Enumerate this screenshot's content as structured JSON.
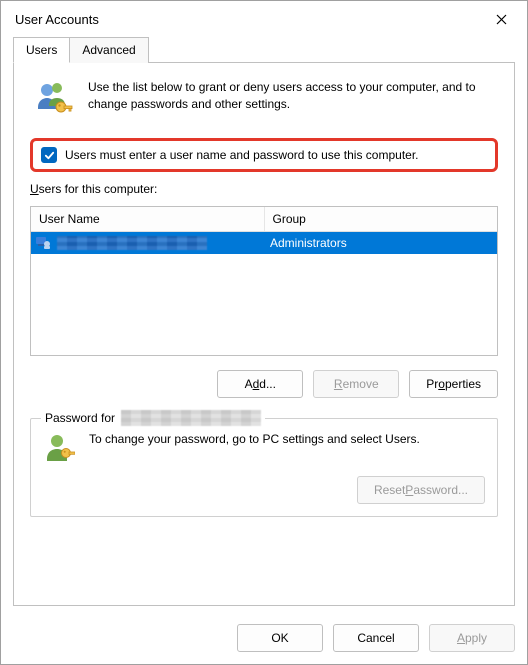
{
  "title": "User Accounts",
  "tabs": {
    "users": "Users",
    "advanced": "Advanced"
  },
  "intro": "Use the list below to grant or deny users access to your computer, and to change passwords and other settings.",
  "require_login_label": "Users must enter a user name and password to use this computer.",
  "require_login_checked": true,
  "users_for_label": "Users for this computer:",
  "columns": {
    "username": "User Name",
    "group": "Group"
  },
  "rows": [
    {
      "username": "",
      "group": "Administrators"
    }
  ],
  "buttons": {
    "add": "Add...",
    "remove": "Remove",
    "properties": "Properties",
    "reset_password": "Reset Password...",
    "ok": "OK",
    "cancel": "Cancel",
    "apply": "Apply"
  },
  "password_legend": "Password for",
  "password_text": "To change your password, go to PC settings and select Users."
}
